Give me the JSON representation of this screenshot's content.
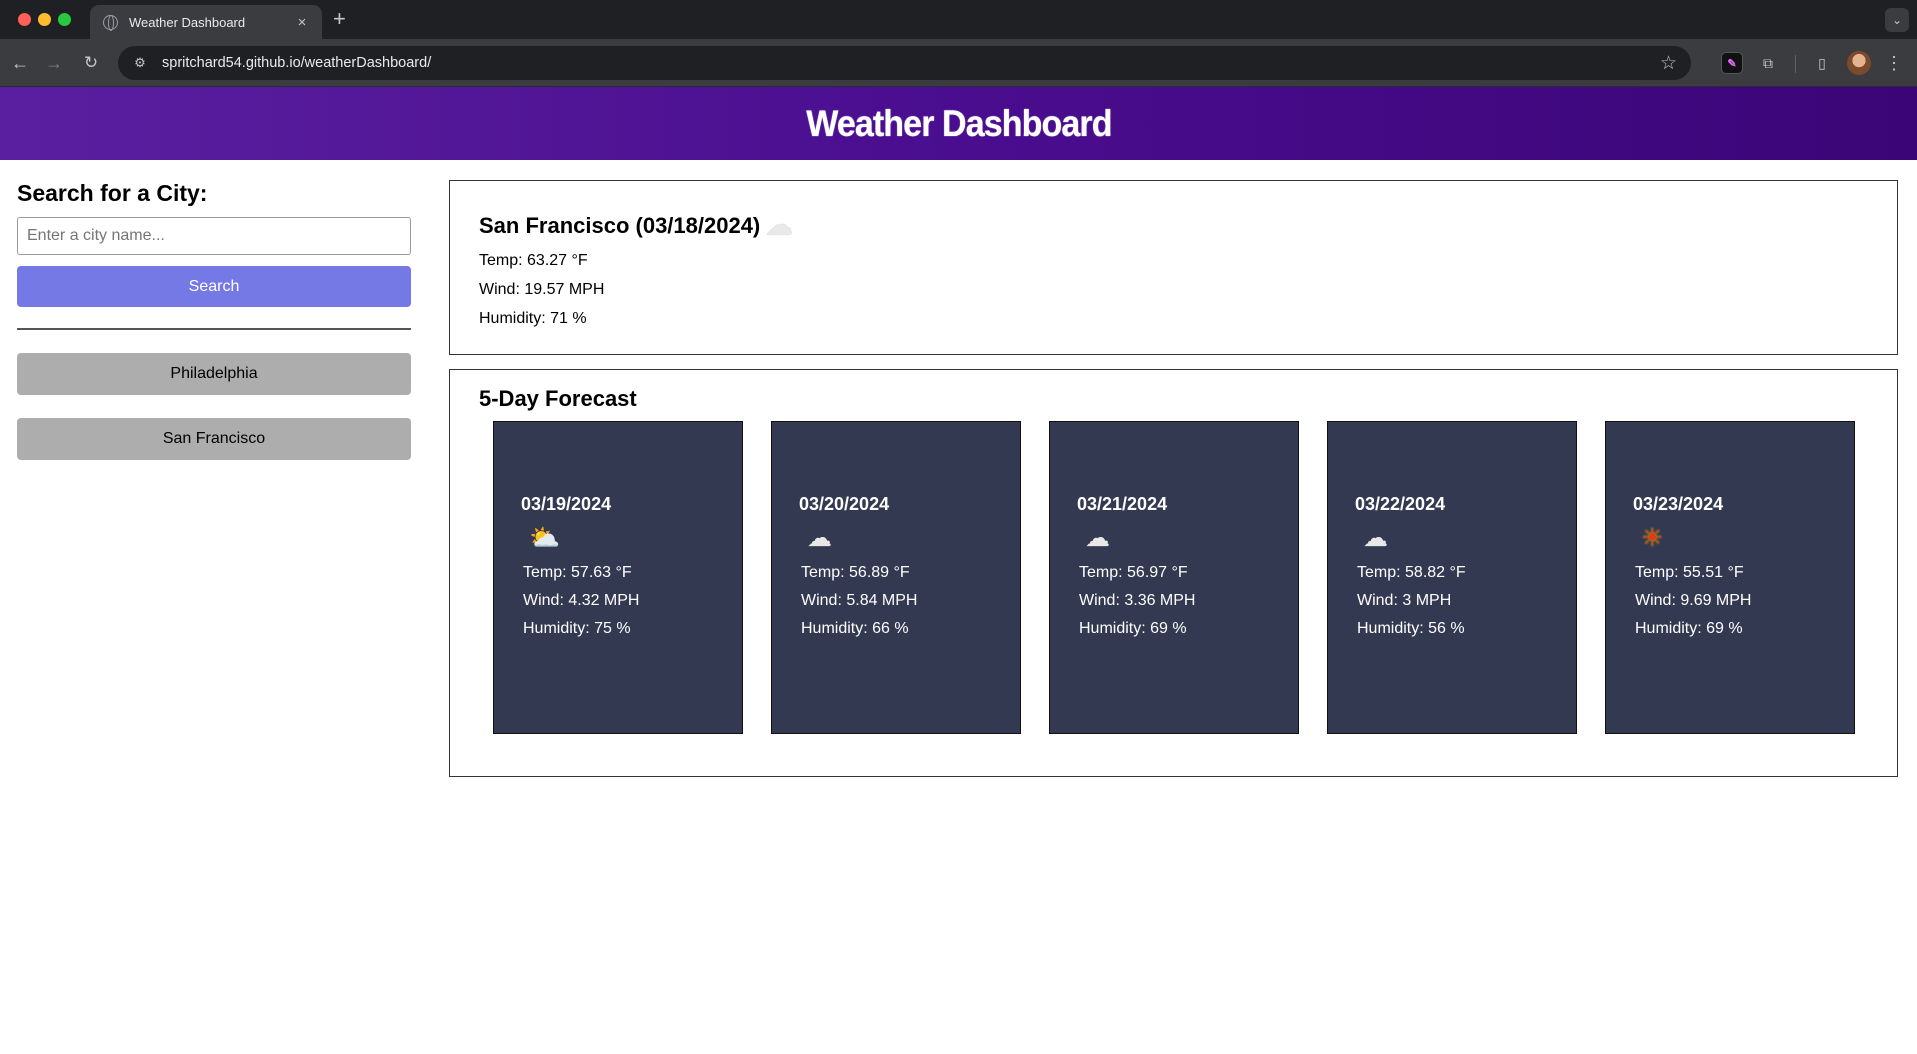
{
  "browser": {
    "tab_title": "Weather Dashboard",
    "tab_close": "×",
    "new_tab": "+",
    "url": "spritchard54.github.io/weatherDashboard/"
  },
  "page": {
    "header_title": "Weather Dashboard"
  },
  "sidebar": {
    "search_label": "Search for a City:",
    "input_placeholder": "Enter a city name...",
    "input_value": "",
    "search_button": "Search",
    "history": [
      "Philadelphia",
      "San Francisco"
    ]
  },
  "current": {
    "title": "San Francisco (03/18/2024)",
    "icon": "cloud-icon",
    "icon_glyph": "☁",
    "temp": "Temp: 63.27 °F",
    "wind": "Wind: 19.57 MPH",
    "humidity": "Humidity: 71 %"
  },
  "forecast": {
    "title": "5-Day Forecast",
    "days": [
      {
        "date": "03/19/2024",
        "icon": "partly-cloudy-icon",
        "glyph": "⛅",
        "temp": "Temp: 57.63 °F",
        "wind": "Wind: 4.32 MPH",
        "humidity": "Humidity: 75 %"
      },
      {
        "date": "03/20/2024",
        "icon": "cloud-icon",
        "glyph": "☁",
        "temp": "Temp: 56.89 °F",
        "wind": "Wind: 5.84 MPH",
        "humidity": "Humidity: 66 %"
      },
      {
        "date": "03/21/2024",
        "icon": "broken-clouds-icon",
        "glyph": "☁",
        "temp": "Temp: 56.97 °F",
        "wind": "Wind: 3.36 MPH",
        "humidity": "Humidity: 69 %"
      },
      {
        "date": "03/22/2024",
        "icon": "broken-clouds-icon",
        "glyph": "☁",
        "temp": "Temp: 58.82 °F",
        "wind": "Wind: 3 MPH",
        "humidity": "Humidity: 56 %"
      },
      {
        "date": "03/23/2024",
        "icon": "sun-icon",
        "glyph": "☀",
        "temp": "Temp: 55.51 °F",
        "wind": "Wind: 9.69 MPH",
        "humidity": "Humidity: 69 %"
      }
    ]
  }
}
